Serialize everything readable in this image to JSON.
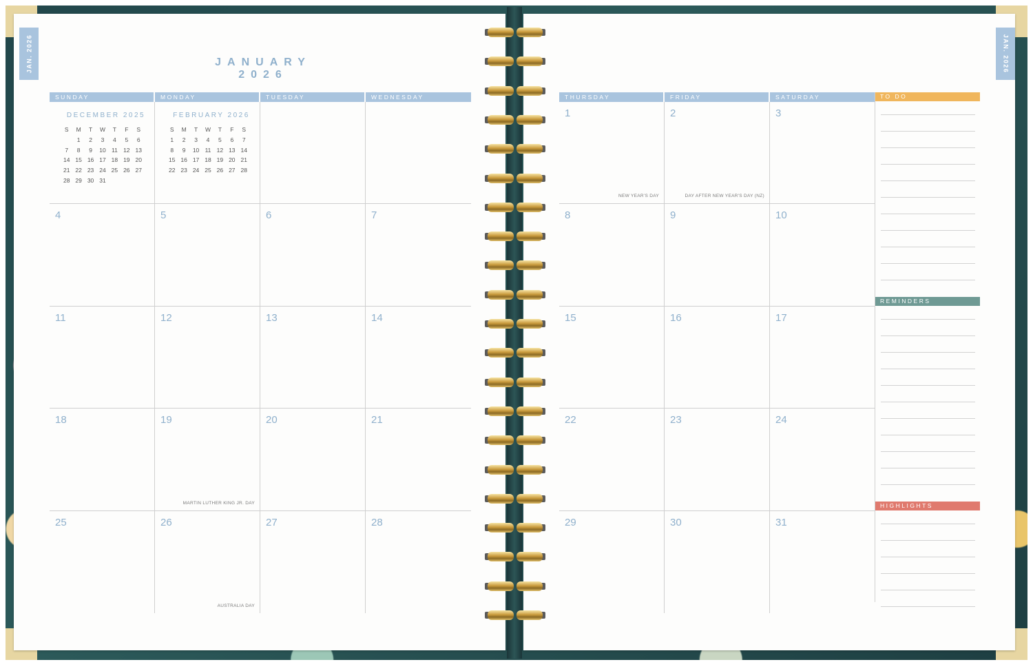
{
  "colors": {
    "weekday_header": "#a9c4de",
    "date_number": "#8fb0cc",
    "todo_header": "#f0b65c",
    "reminders_header": "#6f9a94",
    "highlights_header": "#e07a6e",
    "cover": "#21464a"
  },
  "left_page": {
    "tab_label": "JAN. 2026",
    "month_title": "JANUARY 2026",
    "weekdays": [
      "SUNDAY",
      "MONDAY",
      "TUESDAY",
      "WEDNESDAY"
    ],
    "mini_calendars": [
      {
        "title": "DECEMBER 2025",
        "days_header": [
          "S",
          "M",
          "T",
          "W",
          "T",
          "F",
          "S"
        ],
        "rows": [
          [
            "",
            "1",
            "2",
            "3",
            "4",
            "5",
            "6"
          ],
          [
            "7",
            "8",
            "9",
            "10",
            "11",
            "12",
            "13"
          ],
          [
            "14",
            "15",
            "16",
            "17",
            "18",
            "19",
            "20"
          ],
          [
            "21",
            "22",
            "23",
            "24",
            "25",
            "26",
            "27"
          ],
          [
            "28",
            "29",
            "30",
            "31",
            "",
            "",
            ""
          ]
        ]
      },
      {
        "title": "FEBRUARY 2026",
        "days_header": [
          "S",
          "M",
          "T",
          "W",
          "T",
          "F",
          "S"
        ],
        "rows": [
          [
            "1",
            "2",
            "3",
            "4",
            "5",
            "6",
            "7"
          ],
          [
            "8",
            "9",
            "10",
            "11",
            "12",
            "13",
            "14"
          ],
          [
            "15",
            "16",
            "17",
            "18",
            "19",
            "20",
            "21"
          ],
          [
            "22",
            "23",
            "24",
            "25",
            "26",
            "27",
            "28"
          ]
        ]
      }
    ],
    "weeks": [
      [
        {
          "num": "",
          "holiday": ""
        },
        {
          "num": "",
          "holiday": ""
        },
        {
          "num": "",
          "holiday": ""
        },
        {
          "num": "",
          "holiday": ""
        }
      ],
      [
        {
          "num": "4",
          "holiday": ""
        },
        {
          "num": "5",
          "holiday": ""
        },
        {
          "num": "6",
          "holiday": ""
        },
        {
          "num": "7",
          "holiday": ""
        }
      ],
      [
        {
          "num": "11",
          "holiday": ""
        },
        {
          "num": "12",
          "holiday": ""
        },
        {
          "num": "13",
          "holiday": ""
        },
        {
          "num": "14",
          "holiday": ""
        }
      ],
      [
        {
          "num": "18",
          "holiday": ""
        },
        {
          "num": "19",
          "holiday": "MARTIN LUTHER KING JR. DAY"
        },
        {
          "num": "20",
          "holiday": ""
        },
        {
          "num": "21",
          "holiday": ""
        }
      ],
      [
        {
          "num": "25",
          "holiday": ""
        },
        {
          "num": "26",
          "holiday": "AUSTRALIA DAY"
        },
        {
          "num": "27",
          "holiday": ""
        },
        {
          "num": "28",
          "holiday": ""
        }
      ]
    ]
  },
  "right_page": {
    "tab_label": "JAN. 2026",
    "weekdays": [
      "THURSDAY",
      "FRIDAY",
      "SATURDAY"
    ],
    "weeks": [
      [
        {
          "num": "1",
          "holiday": "NEW YEAR'S DAY"
        },
        {
          "num": "2",
          "holiday": "DAY AFTER NEW YEAR'S DAY (NZ)"
        },
        {
          "num": "3",
          "holiday": ""
        }
      ],
      [
        {
          "num": "8",
          "holiday": ""
        },
        {
          "num": "9",
          "holiday": ""
        },
        {
          "num": "10",
          "holiday": ""
        }
      ],
      [
        {
          "num": "15",
          "holiday": ""
        },
        {
          "num": "16",
          "holiday": ""
        },
        {
          "num": "17",
          "holiday": ""
        }
      ],
      [
        {
          "num": "22",
          "holiday": ""
        },
        {
          "num": "23",
          "holiday": ""
        },
        {
          "num": "24",
          "holiday": ""
        }
      ],
      [
        {
          "num": "29",
          "holiday": ""
        },
        {
          "num": "30",
          "holiday": ""
        },
        {
          "num": "31",
          "holiday": ""
        }
      ]
    ],
    "sidebar": {
      "todo_label": "TO DO",
      "reminders_label": "REMINDERS",
      "highlights_label": "HIGHLIGHTS"
    }
  }
}
